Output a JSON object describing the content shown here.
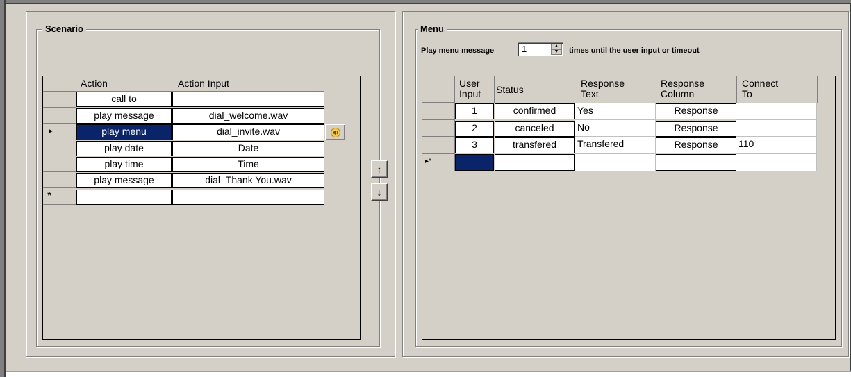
{
  "scenario": {
    "title": "Scenario",
    "columns": [
      "Action",
      "Action Input"
    ],
    "rows": [
      {
        "action": "call to",
        "input": ""
      },
      {
        "action": "play message",
        "input": "dial_welcome.wav"
      },
      {
        "action": "play menu",
        "input": "dial_invite.wav",
        "selected": true
      },
      {
        "action": "play date",
        "input": "Date"
      },
      {
        "action": "play time",
        "input": "Time"
      },
      {
        "action": "play message",
        "input": "dial_Thank You.wav"
      }
    ],
    "current_marker": "▸",
    "new_row_marker": "*"
  },
  "menu": {
    "title": "Menu",
    "play_label": "Play menu message",
    "repeat_value": "1",
    "repeat_suffix": "times until the user input or timeout",
    "columns": [
      {
        "l1": "User",
        "l2": "Input"
      },
      {
        "l1": "Status",
        "l2": ""
      },
      {
        "l1": "Response",
        "l2": "Text"
      },
      {
        "l1": "Response",
        "l2": "Column"
      },
      {
        "l1": "Connect",
        "l2": "To"
      }
    ],
    "rows": [
      {
        "input": "1",
        "status": "confirmed",
        "text": "Yes",
        "column": "Response",
        "connect": ""
      },
      {
        "input": "2",
        "status": "canceled",
        "text": "No",
        "column": "Response",
        "connect": ""
      },
      {
        "input": "3",
        "status": "transfered",
        "text": "Transfered",
        "column": "Response",
        "connect": "110"
      }
    ],
    "new_row_marker": "▸*"
  },
  "buttons": {
    "move_up": "↑",
    "move_down": "↓"
  },
  "icons": {
    "play_sound": "speaker-icon"
  },
  "colors": {
    "background": "#d4d0c8",
    "selection": "#0a246a"
  }
}
